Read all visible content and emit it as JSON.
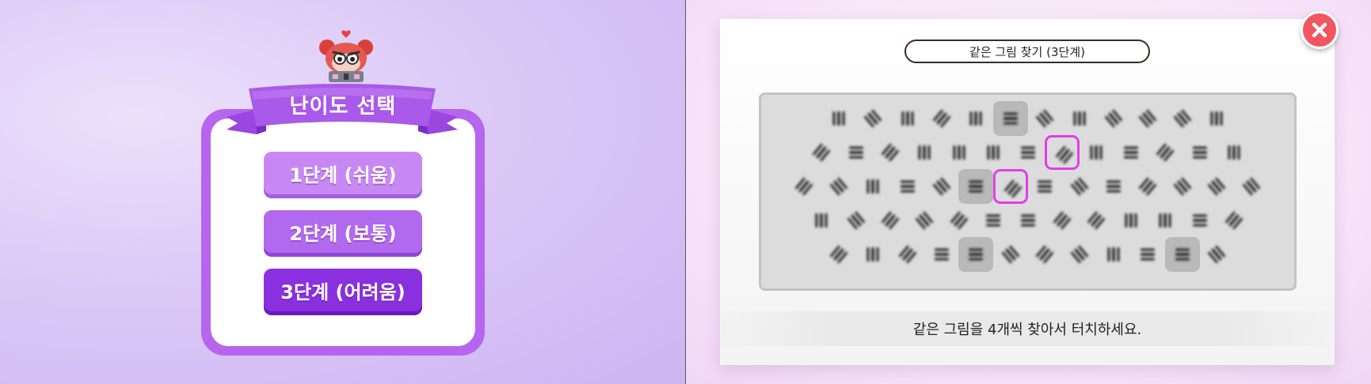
{
  "difficulty_menu": {
    "title": "난이도 선택",
    "buttons": [
      {
        "label": "1단계 (쉬움)"
      },
      {
        "label": "2단계 (보통)"
      },
      {
        "label": "3단계 (어려움)"
      }
    ]
  },
  "game": {
    "stage_title": "같은 그림 찾기 (3단계)",
    "instruction": "같은 그림을 4개씩 찾아서 터치하세요.",
    "close_icon": "close-icon",
    "colors": {
      "menu_frame": "#b665ef",
      "selected_outline": "#e040e6",
      "close_button": "#f2555f"
    },
    "grid": {
      "rows": [
        [
          "v",
          "d2",
          "v",
          "d1",
          "v",
          "h",
          "d2",
          "v",
          "d2",
          "d2",
          "d2",
          "v"
        ],
        [
          "d1",
          "h",
          "d1",
          "v",
          "v",
          "v",
          "h",
          "d1",
          "v",
          "h",
          "d1",
          "h",
          "v"
        ],
        [
          "d1",
          "d2",
          "v",
          "h",
          "d2",
          "h",
          "d1",
          "h",
          "d2",
          "h",
          "d1",
          "d2",
          "d2",
          "d2"
        ],
        [
          "v",
          "d2",
          "d1",
          "d2",
          "d1",
          "h",
          "h",
          "d1",
          "d1",
          "v",
          "v",
          "h",
          "d1"
        ],
        [
          "d1",
          "v",
          "d1",
          "h",
          "h",
          "d2",
          "d1",
          "d2",
          "v",
          "h",
          "h",
          "d2"
        ]
      ],
      "highlighted_cells": [
        "0-5",
        "2-5",
        "4-4",
        "4-10"
      ],
      "selected_cells": [
        "1-7",
        "2-6"
      ]
    }
  }
}
